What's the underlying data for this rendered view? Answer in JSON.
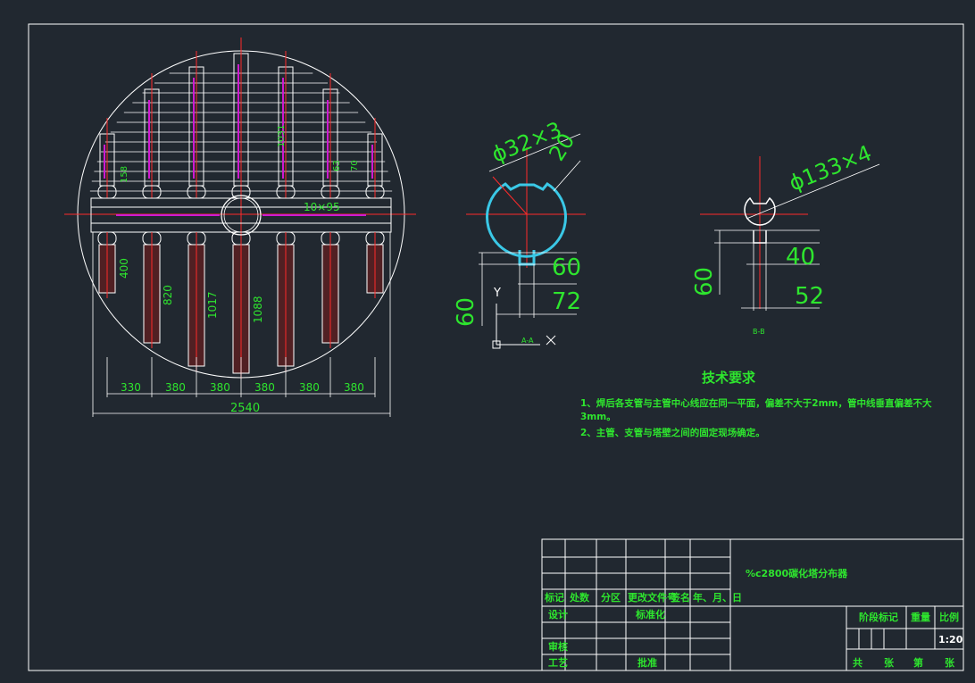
{
  "colors": {
    "background": "#212830",
    "lines": "#ffffff",
    "text": "#2ee52e",
    "centerline": "#ff2a2a",
    "pipe_fill": "#7a1a1a",
    "accent_magenta": "#d01ad0",
    "section_pipe": "#3ac8e6"
  },
  "main_view": {
    "dims_vertical": [
      "400",
      "820",
      "1017",
      "1088"
    ],
    "dims_bottom": [
      "330",
      "380",
      "380",
      "380",
      "380",
      "380"
    ],
    "total_width": "2540",
    "spacing_note": "10×95",
    "upper_dims": [
      "158",
      "70",
      "63",
      "1031"
    ]
  },
  "section_a": {
    "pipe_label": "ϕ32×3",
    "width_label": "20",
    "dim_60": "60",
    "dim_72": "72",
    "dim_60_vertical": "60",
    "axis_y": "Y",
    "axis_label": "A-A"
  },
  "section_b": {
    "pipe_label": "ϕ133×4",
    "dim_40": "40",
    "dim_52": "52",
    "dim_60_vertical": "60",
    "label": "B-B"
  },
  "technical_requirements": {
    "title": "技术要求",
    "line1": "1、焊后各支管与主管中心线应在同一平面，偏差不大于2mm，管中线垂直偏差不大",
    "line1_cont": "3mm。",
    "line2": "2、主管、支管与塔壁之间的固定现场确定。"
  },
  "title_block": {
    "drawing_title": "%c2800碳化塔分布器",
    "headers": [
      "标记",
      "处数",
      "分区",
      "更改文件号",
      "签名",
      "年、月、日"
    ],
    "design": "设计",
    "standardize": "标准化",
    "review": "审核",
    "process": "工艺",
    "approve": "批准",
    "stage_mark": "阶段标记",
    "weight": "重量",
    "scale": "比例",
    "scale_value": "1:20",
    "total": "共",
    "sheets": "张",
    "page": "第",
    "sheet": "张"
  }
}
